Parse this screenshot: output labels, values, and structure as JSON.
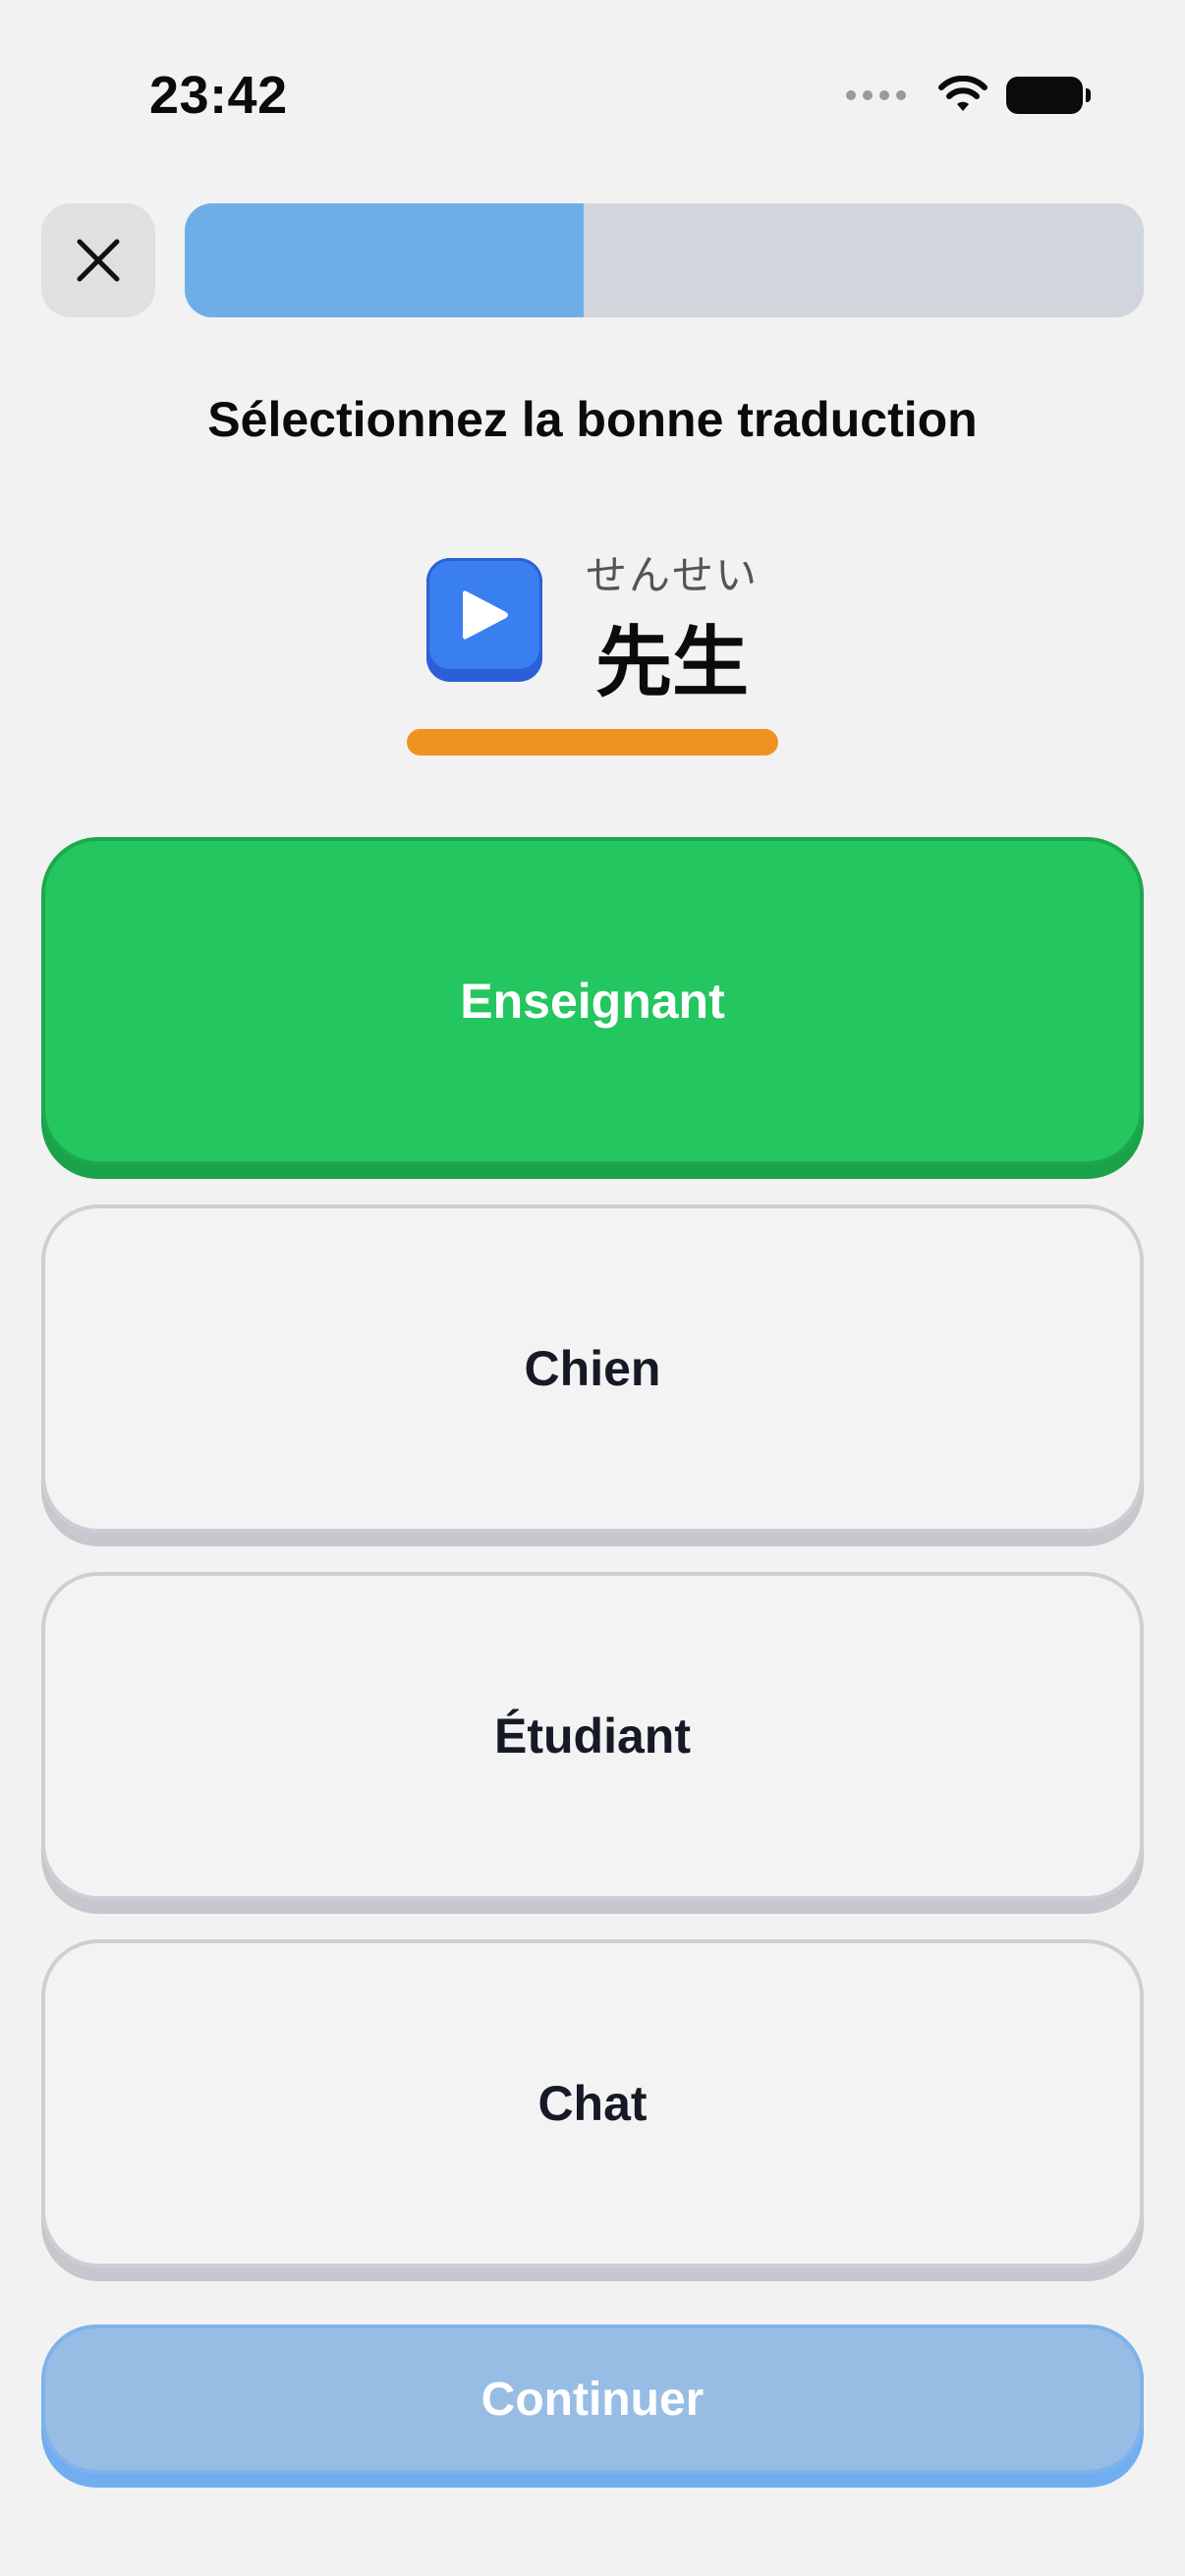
{
  "status_bar": {
    "time": "23:42"
  },
  "header": {
    "close_icon": "close-x-icon",
    "progress": 0.416
  },
  "instruction": "Sélectionnez la bonne traduction",
  "word": {
    "reading": "せんせい",
    "text": "先生",
    "play_icon": "play-icon"
  },
  "options": [
    {
      "label": "Enseignant",
      "state": "correct"
    },
    {
      "label": "Chien",
      "state": "default"
    },
    {
      "label": "Étudiant",
      "state": "default"
    },
    {
      "label": "Chat",
      "state": "default"
    }
  ],
  "continue_label": "Continuer",
  "colors": {
    "correct": "#23c65f",
    "progress": "#6daee9",
    "accent_underline": "#ee9322",
    "play_button": "#3a7ff0",
    "continue_disabled": "#98bde4"
  }
}
